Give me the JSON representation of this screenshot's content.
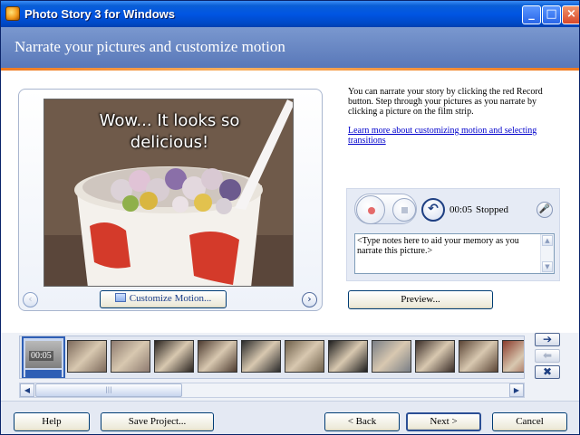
{
  "window": {
    "title": "Photo Story 3 for Windows",
    "minimize_glyph": "_",
    "maximize_glyph": "□",
    "close_glyph": "×"
  },
  "header": {
    "heading": "Narrate your pictures and customize motion"
  },
  "photo": {
    "caption": "Wow... It looks so\ndelicious!"
  },
  "preview_nav": {
    "prev_glyph": "‹",
    "next_glyph": "›"
  },
  "customize_button": {
    "label": "Customize Motion..."
  },
  "instructions": {
    "text": "You can narrate your story by clicking the red Record button. Step through your pictures as you narrate by clicking a picture on the film strip.",
    "link": "Learn more about customizing motion and selecting transitions"
  },
  "recorder": {
    "timer": "00:05",
    "status": "Stopped",
    "undo_glyph": "↶",
    "mic_glyph": "🎤",
    "notes_value": "<Type notes here to aid your memory as you narrate this picture.>"
  },
  "preview_button": {
    "label": "Preview..."
  },
  "filmstrip": {
    "selected_time": "00:05",
    "thumb_colors": [
      "#7d6a5c",
      "#8e7b70",
      "#2a2420",
      "#4d3b30",
      "#2b2b2b",
      "#6e5f4a",
      "#1e1e1e",
      "#7a7f86",
      "#3a2d28",
      "#5b4536",
      "#8a3b2c",
      "#6a5a48"
    ],
    "scroll_left": "◀",
    "scroll_right": "▶",
    "grip": "|||"
  },
  "filmstrip_tools": {
    "move_right": "➔",
    "move_left": "⬅",
    "remove": "✖"
  },
  "footer": {
    "help": "Help",
    "save": "Save Project...",
    "back": "< Back",
    "next": "Next >",
    "cancel": "Cancel"
  }
}
